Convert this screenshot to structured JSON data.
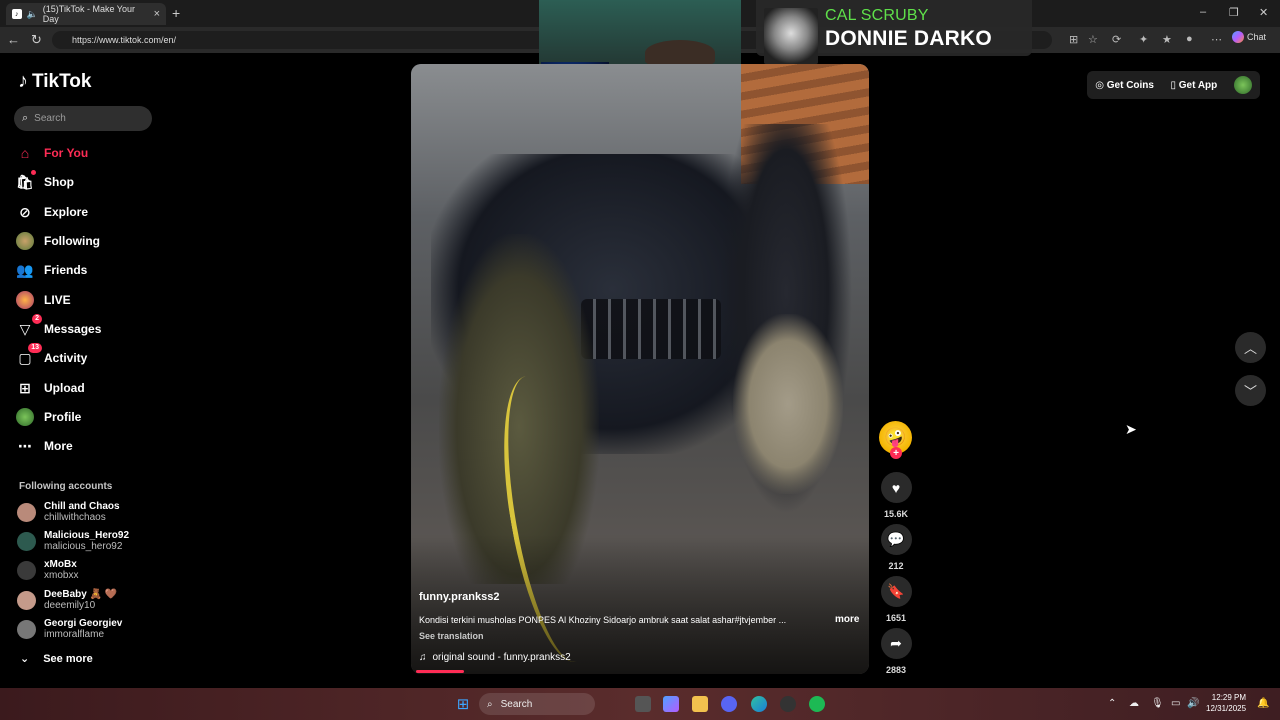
{
  "browser": {
    "tab_title": "(15)TikTok - Make Your Day",
    "url": "https://www.tiktok.com/en/",
    "chat_label": "Chat"
  },
  "overlay": {
    "artist": "CAL SCRUBY",
    "song": "DONNIE DARKO"
  },
  "sidebar": {
    "logo": "TikTok",
    "search_placeholder": "Search",
    "items": [
      {
        "label": "For You",
        "icon": "home-icon"
      },
      {
        "label": "Shop",
        "icon": "shop-icon"
      },
      {
        "label": "Explore",
        "icon": "compass-icon"
      },
      {
        "label": "Following",
        "icon": "following-avatar-icon"
      },
      {
        "label": "Friends",
        "icon": "friends-icon"
      },
      {
        "label": "LIVE",
        "icon": "live-avatar-icon"
      },
      {
        "label": "Messages",
        "icon": "messages-icon",
        "badge": "2"
      },
      {
        "label": "Activity",
        "icon": "activity-icon",
        "badge": "13"
      },
      {
        "label": "Upload",
        "icon": "upload-icon"
      },
      {
        "label": "Profile",
        "icon": "profile-avatar-icon"
      },
      {
        "label": "More",
        "icon": "more-icon"
      }
    ],
    "following_heading": "Following accounts",
    "accounts": [
      {
        "name": "Chill and Chaos",
        "handle": "chillwithchaos",
        "color": "#b98a7a"
      },
      {
        "name": "Malicious_Hero92",
        "handle": "malicious_hero92",
        "color": "#2d5a4f"
      },
      {
        "name": "xMoBx",
        "handle": "xmobxx",
        "color": "#3a3a3a"
      },
      {
        "name": "DeeBaby 🧸 🤎",
        "handle": "deeemily10",
        "color": "#c49a8a"
      },
      {
        "name": "Georgi Georgiev",
        "handle": "immoralflame",
        "color": "#777777"
      }
    ],
    "see_more": "See more"
  },
  "video": {
    "username": "funny.prankss2",
    "caption": "Kondisi terkini musholas PONPES Al Khoziny Sidoarjo ambruk saat salat ashar#jtvjember ...",
    "more": "more",
    "see_translation": "See translation",
    "sound": "original sound - funny.prankss2",
    "progress": 0.1
  },
  "actions": {
    "likes": "15.6K",
    "comments": "212",
    "saves": "1651",
    "shares": "2883"
  },
  "topright": {
    "get_coins": "Get Coins",
    "get_app": "Get App"
  },
  "taskbar": {
    "search": "Search",
    "time": "12:29 PM",
    "date": "12/31/2025"
  },
  "colors": {
    "accent": "#fe2c55",
    "overlay_artist": "#5fe04a"
  }
}
